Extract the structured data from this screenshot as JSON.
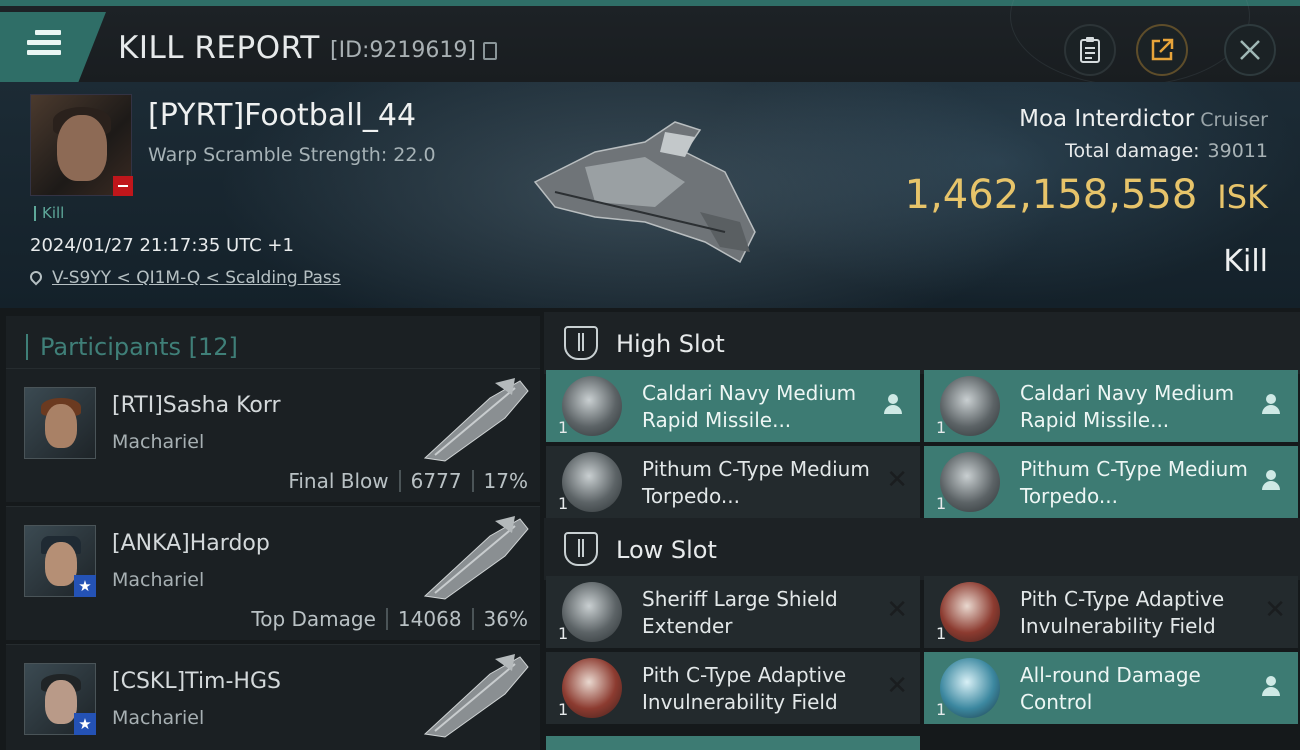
{
  "header": {
    "title": "KILL REPORT",
    "kill_id": "[ID:9219619]"
  },
  "victim": {
    "name": "[PYRT]Football_44",
    "warp_scramble": "Warp Scramble Strength: 22.0",
    "tag": "Kill",
    "datetime": "2024/01/27 21:17:35 UTC +1",
    "location": "V-S9YY < QI1M-Q < Scalding Pass",
    "ship_name": "Moa Interdictor",
    "ship_class": "Cruiser",
    "total_damage_label": "Total damage:",
    "total_damage_value": "39011",
    "isk_value": "1,462,158,558",
    "isk_unit": "ISK",
    "result": "Kill"
  },
  "participants": {
    "title": "Participants [12]",
    "items": [
      {
        "name": "[RTI]Sasha Korr",
        "ship": "Machariel",
        "role": "Final Blow",
        "damage": "6777",
        "percent": "17%",
        "badge": ""
      },
      {
        "name": "[ANKA]Hardop",
        "ship": "Machariel",
        "role": "Top Damage",
        "damage": "14068",
        "percent": "36%",
        "badge": "★"
      },
      {
        "name": "[CSKL]Tim-HGS",
        "ship": "Machariel",
        "role": "",
        "damage": "",
        "percent": "",
        "badge": "★"
      }
    ]
  },
  "slots": {
    "high": {
      "title": "High Slot",
      "modules": [
        {
          "name": "Caldari Navy Medium Rapid Missile...",
          "qty": "1",
          "status": "person"
        },
        {
          "name": "Caldari Navy Medium Rapid Missile...",
          "qty": "1",
          "status": "person"
        },
        {
          "name": "Pithum C-Type Medium Torpedo...",
          "qty": "1",
          "status": "x"
        },
        {
          "name": "Pithum C-Type Medium Torpedo...",
          "qty": "1",
          "status": "person"
        }
      ]
    },
    "low": {
      "title": "Low Slot",
      "modules": [
        {
          "name": "Sheriff Large Shield Extender",
          "qty": "1",
          "status": "x"
        },
        {
          "name": "Pith C-Type Adaptive Invulnerability Field",
          "qty": "1",
          "status": "x"
        },
        {
          "name": "Pith C-Type Adaptive Invulnerability Field",
          "qty": "1",
          "status": "x"
        },
        {
          "name": "All-round Damage Control",
          "qty": "1",
          "status": "person"
        }
      ]
    }
  },
  "colors": {
    "accent": "#3d7b73",
    "isk": "#e7c46a",
    "badge_red": "#c0161b",
    "badge_blue": "#2452b5"
  },
  "icons": {
    "menu": "menu-icon",
    "clipboard": "clipboard-icon",
    "share": "share-icon",
    "close": "close-icon",
    "location": "location-pin-icon"
  }
}
